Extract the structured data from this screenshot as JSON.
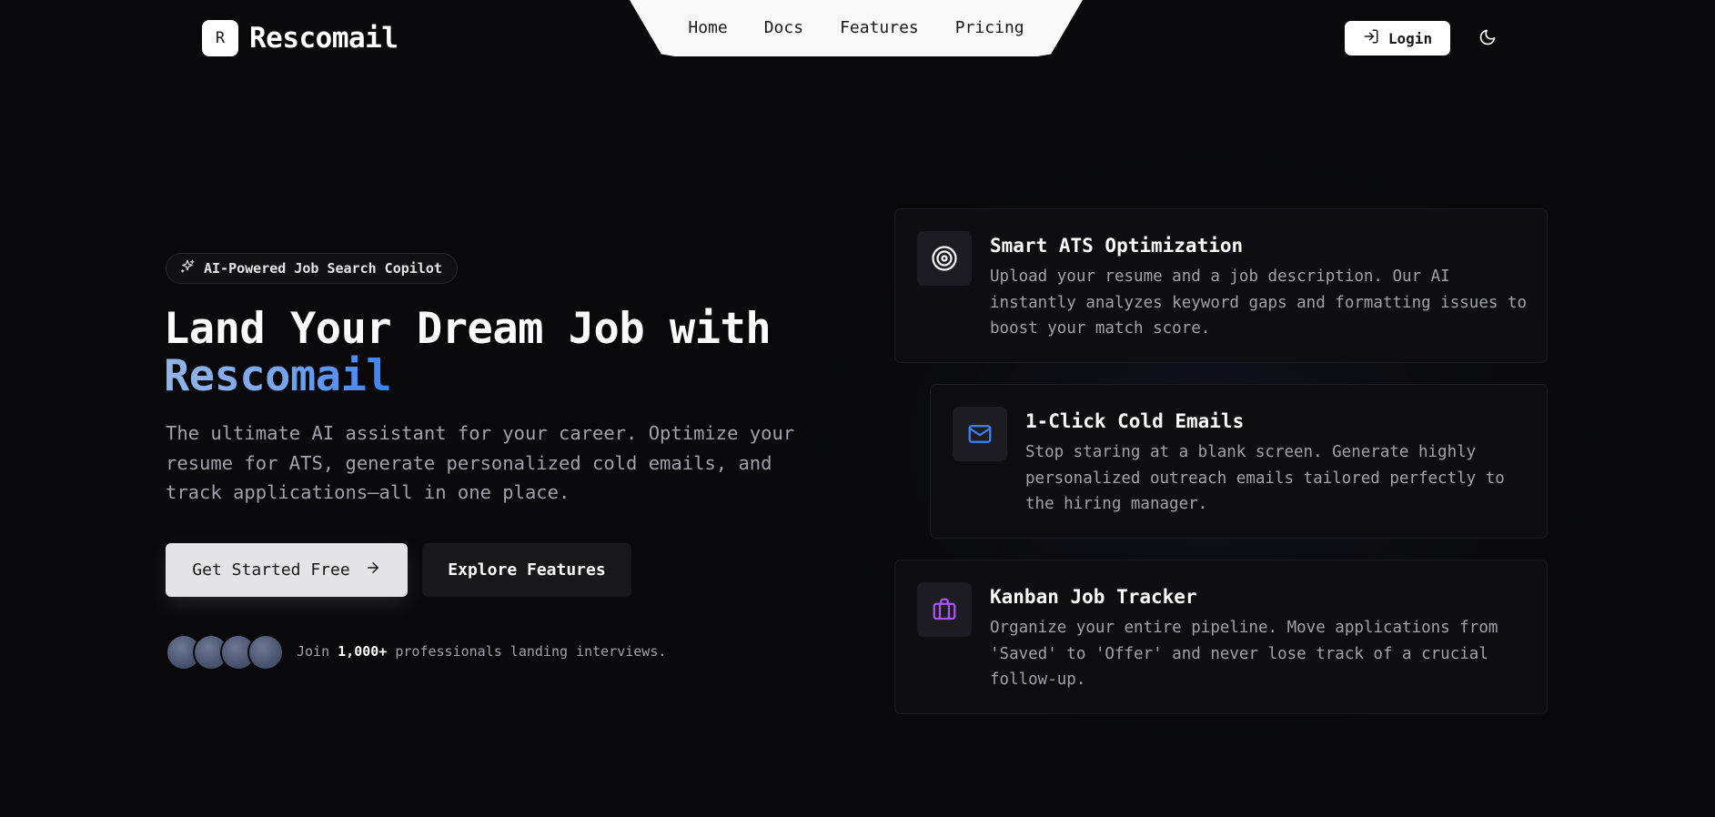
{
  "brand": {
    "mark": "R",
    "name": "Rescomail"
  },
  "nav": {
    "items": [
      "Home",
      "Docs",
      "Features",
      "Pricing"
    ]
  },
  "header": {
    "login_label": "Login"
  },
  "hero": {
    "badge": "AI-Powered Job Search Copilot",
    "title_line1": "Land Your Dream Job with",
    "title_accent": "Rescomail",
    "subtitle": "The ultimate AI assistant for your career. Optimize your resume for ATS, generate personalized cold emails, and track applications—all in one place.",
    "primary_cta": "Get Started Free",
    "secondary_cta": "Explore Features",
    "social_prefix": "Join",
    "social_count": "1,000+",
    "social_suffix": "professionals landing interviews."
  },
  "features": [
    {
      "icon": "target-icon",
      "title": "Smart ATS Optimization",
      "description": "Upload your resume and a job description. Our AI instantly analyzes keyword gaps and formatting issues to boost your match score."
    },
    {
      "icon": "mail-icon",
      "title": "1-Click Cold Emails",
      "description": "Stop staring at a blank screen. Generate highly personalized outreach emails tailored perfectly to the hiring manager."
    },
    {
      "icon": "briefcase-icon",
      "title": "Kanban Job Tracker",
      "description": "Organize your entire pipeline. Move applications from 'Saved' to 'Offer' and never lose track of a crucial follow-up."
    }
  ],
  "colors": {
    "background": "#09090b",
    "accent_blue": "#3b82f6",
    "accent_purple": "#a855f7",
    "muted_text": "#a1a1aa"
  }
}
